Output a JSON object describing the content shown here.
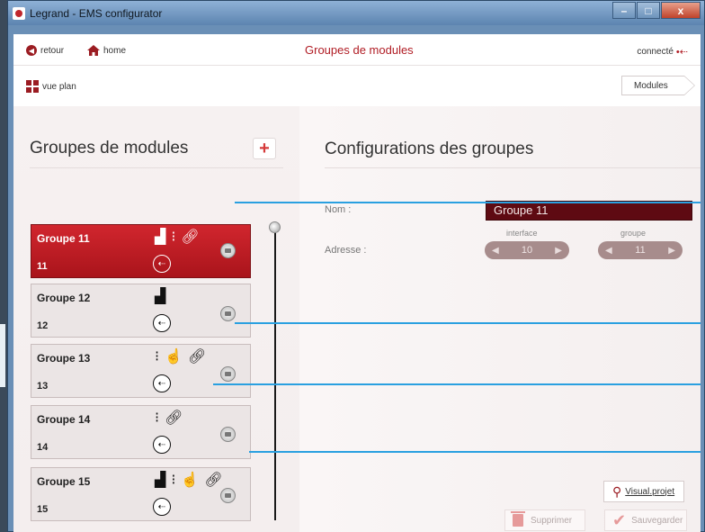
{
  "window": {
    "title": "Legrand - EMS configurator",
    "controls": {
      "minimize": "–",
      "maximize": "□",
      "close": "x"
    }
  },
  "header": {
    "back_label": "retour",
    "home_label": "home",
    "page_title": "Groupes de modules",
    "connection_status": "connecté",
    "vue_plan_label": "vue plan",
    "modules_tab_label": "Modules"
  },
  "left_panel": {
    "title": "Groupes de modules",
    "add_label": "+",
    "groups": [
      {
        "name": "Groupe 11",
        "number": "11",
        "icons": [
          "chart-icon",
          "traffic-light-icon",
          "link-icon"
        ],
        "selected": true
      },
      {
        "name": "Groupe 12",
        "number": "12",
        "icons": [
          "chart-icon"
        ],
        "selected": false
      },
      {
        "name": "Groupe 13",
        "number": "13",
        "icons": [
          "traffic-light-icon",
          "hand-pointer-icon",
          "link-icon"
        ],
        "selected": false
      },
      {
        "name": "Groupe 14",
        "number": "14",
        "icons": [
          "traffic-light-icon",
          "link-icon"
        ],
        "selected": false
      },
      {
        "name": "Groupe 15",
        "number": "15",
        "icons": [
          "chart-icon",
          "traffic-light-icon",
          "hand-pointer-icon",
          "link-icon"
        ],
        "selected": false
      }
    ]
  },
  "right_panel": {
    "title": "Configurations des groupes",
    "name_label": "Nom :",
    "name_value": "Groupe 11",
    "address_label": "Adresse :",
    "interface_caption": "interface",
    "interface_value": "10",
    "groupe_caption": "groupe",
    "groupe_value": "11",
    "visual_button": "Visual.projet",
    "delete_button": "Supprimer",
    "save_button": "Sauvegarder"
  },
  "colors": {
    "accent": "#b01c24",
    "selected_group": "#c01d25",
    "connector_line": "#2aa0e0"
  }
}
